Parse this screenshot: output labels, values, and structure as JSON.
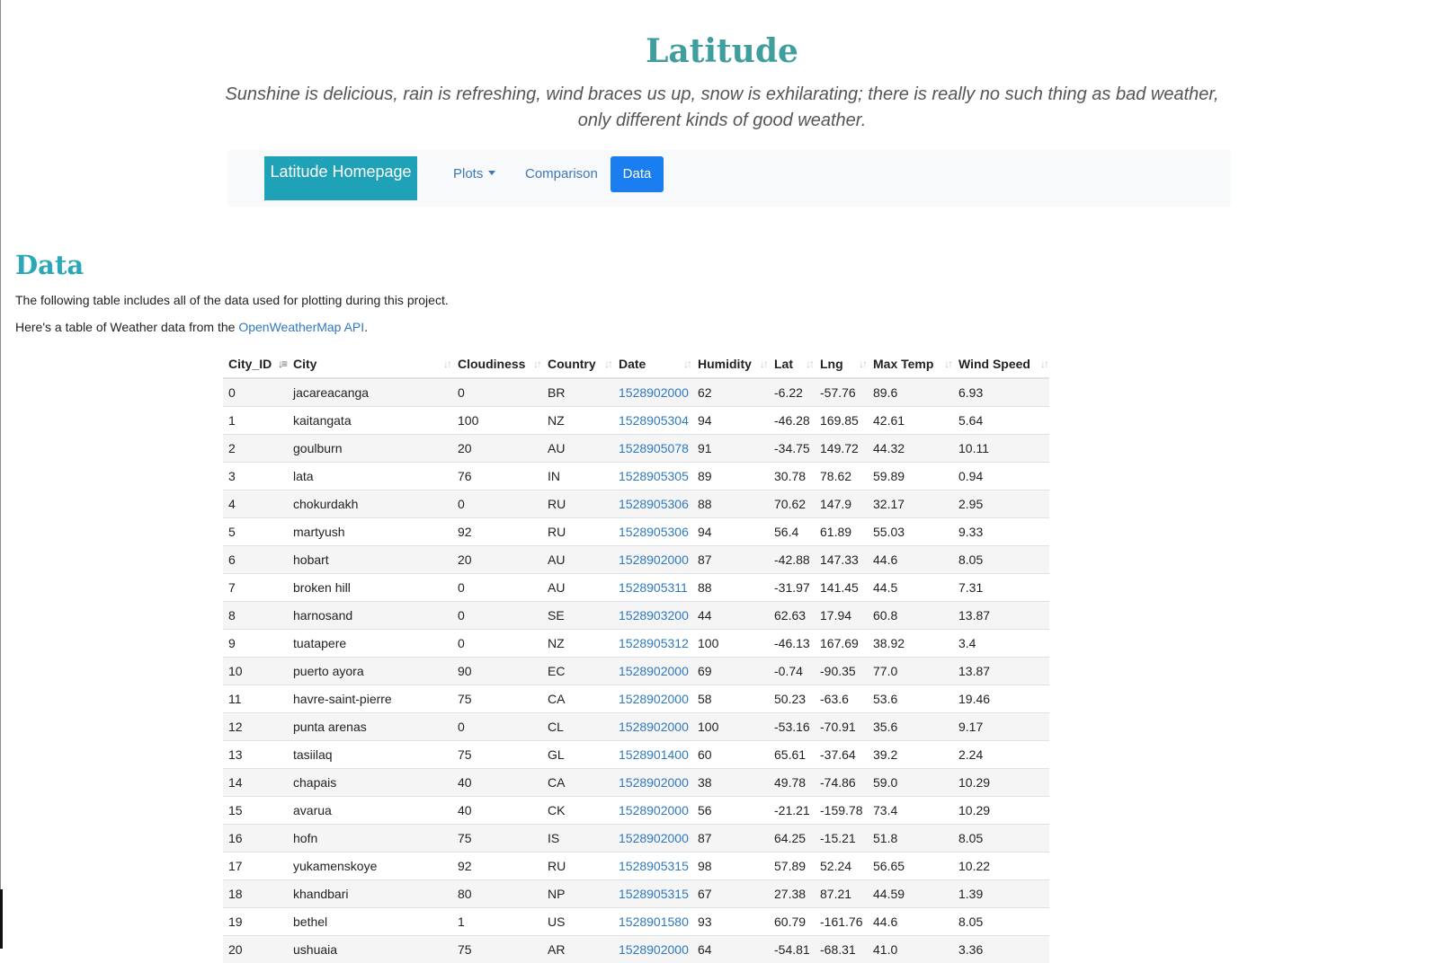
{
  "header": {
    "title": "Latitude",
    "quote": "Sunshine is delicious, rain is refreshing, wind braces us up, snow is exhilarating; there is really no such thing as bad weather, only different kinds of good weather."
  },
  "navbar": {
    "brand": "Latitude Homepage",
    "items": [
      {
        "label": "Plots"
      },
      {
        "label": "Comparison"
      },
      {
        "label": "Data"
      }
    ]
  },
  "section": {
    "heading": "Data",
    "paragraph1": "The following table includes all of the data used for plotting during this project.",
    "paragraph2_prefix": "Here's a table of Weather data from the ",
    "paragraph2_link": "OpenWeatherMap API",
    "paragraph2_suffix": "."
  },
  "table": {
    "columns": [
      "City_ID",
      "City",
      "Cloudiness",
      "Country",
      "Date",
      "Humidity",
      "Lat",
      "Lng",
      "Max Temp",
      "Wind Speed"
    ],
    "rows": [
      [
        "0",
        "jacareacanga",
        "0",
        "BR",
        "1528902000",
        "62",
        "-6.22",
        "-57.76",
        "89.6",
        "6.93"
      ],
      [
        "1",
        "kaitangata",
        "100",
        "NZ",
        "1528905304",
        "94",
        "-46.28",
        "169.85",
        "42.61",
        "5.64"
      ],
      [
        "2",
        "goulburn",
        "20",
        "AU",
        "1528905078",
        "91",
        "-34.75",
        "149.72",
        "44.32",
        "10.11"
      ],
      [
        "3",
        "lata",
        "76",
        "IN",
        "1528905305",
        "89",
        "30.78",
        "78.62",
        "59.89",
        "0.94"
      ],
      [
        "4",
        "chokurdakh",
        "0",
        "RU",
        "1528905306",
        "88",
        "70.62",
        "147.9",
        "32.17",
        "2.95"
      ],
      [
        "5",
        "martyush",
        "92",
        "RU",
        "1528905306",
        "94",
        "56.4",
        "61.89",
        "55.03",
        "9.33"
      ],
      [
        "6",
        "hobart",
        "20",
        "AU",
        "1528902000",
        "87",
        "-42.88",
        "147.33",
        "44.6",
        "8.05"
      ],
      [
        "7",
        "broken hill",
        "0",
        "AU",
        "1528905311",
        "88",
        "-31.97",
        "141.45",
        "44.5",
        "7.31"
      ],
      [
        "8",
        "harnosand",
        "0",
        "SE",
        "1528903200",
        "44",
        "62.63",
        "17.94",
        "60.8",
        "13.87"
      ],
      [
        "9",
        "tuatapere",
        "0",
        "NZ",
        "1528905312",
        "100",
        "-46.13",
        "167.69",
        "38.92",
        "3.4"
      ],
      [
        "10",
        "puerto ayora",
        "90",
        "EC",
        "1528902000",
        "69",
        "-0.74",
        "-90.35",
        "77.0",
        "13.87"
      ],
      [
        "11",
        "havre-saint-pierre",
        "75",
        "CA",
        "1528902000",
        "58",
        "50.23",
        "-63.6",
        "53.6",
        "19.46"
      ],
      [
        "12",
        "punta arenas",
        "0",
        "CL",
        "1528902000",
        "100",
        "-53.16",
        "-70.91",
        "35.6",
        "9.17"
      ],
      [
        "13",
        "tasiilaq",
        "75",
        "GL",
        "1528901400",
        "60",
        "65.61",
        "-37.64",
        "39.2",
        "2.24"
      ],
      [
        "14",
        "chapais",
        "40",
        "CA",
        "1528902000",
        "38",
        "49.78",
        "-74.86",
        "59.0",
        "10.29"
      ],
      [
        "15",
        "avarua",
        "40",
        "CK",
        "1528902000",
        "56",
        "-21.21",
        "-159.78",
        "73.4",
        "10.29"
      ],
      [
        "16",
        "hofn",
        "75",
        "IS",
        "1528902000",
        "87",
        "64.25",
        "-15.21",
        "51.8",
        "8.05"
      ],
      [
        "17",
        "yukamenskoye",
        "92",
        "RU",
        "1528905315",
        "98",
        "57.89",
        "52.24",
        "56.65",
        "10.22"
      ],
      [
        "18",
        "khandbari",
        "80",
        "NP",
        "1528905315",
        "67",
        "27.38",
        "87.21",
        "44.59",
        "1.39"
      ],
      [
        "19",
        "bethel",
        "1",
        "US",
        "1528901580",
        "93",
        "60.79",
        "-161.76",
        "44.6",
        "8.05"
      ],
      [
        "20",
        "ushuaia",
        "75",
        "AR",
        "1528902000",
        "64",
        "-54.81",
        "-68.31",
        "41.0",
        "3.36"
      ]
    ]
  }
}
